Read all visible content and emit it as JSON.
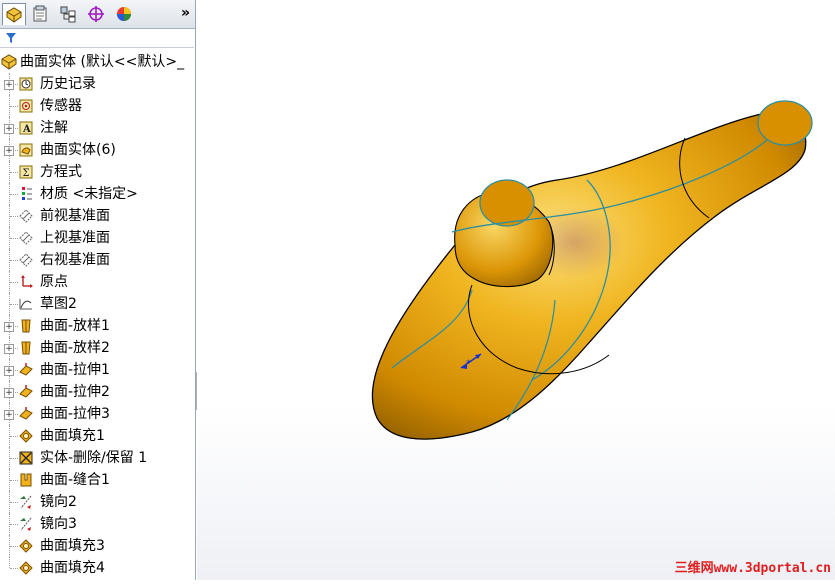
{
  "toolbar": {
    "tabs": [
      {
        "name": "feature-manager",
        "icon": "feature-tree-icon",
        "active": true
      },
      {
        "name": "property-manager",
        "icon": "property-manager-icon",
        "active": false
      },
      {
        "name": "configuration-manager",
        "icon": "configuration-icon",
        "active": false
      },
      {
        "name": "dimxpert",
        "icon": "crosshair-icon",
        "active": false
      },
      {
        "name": "display-manager",
        "icon": "appearance-icon",
        "active": false
      }
    ],
    "more": "»"
  },
  "filter": {
    "icon": "filter-icon"
  },
  "tree": {
    "root": {
      "label": "曲面实体  (默认<<默认>_",
      "icon": "part-icon"
    },
    "items": [
      {
        "label": "历史记录",
        "icon": "history-icon",
        "expandable": true
      },
      {
        "label": "传感器",
        "icon": "sensor-icon",
        "expandable": false
      },
      {
        "label": "注解",
        "icon": "annotation-icon",
        "expandable": true
      },
      {
        "label": "曲面实体(6)",
        "icon": "surface-bodies-icon",
        "expandable": true
      },
      {
        "label": "方程式",
        "icon": "equations-icon",
        "expandable": false
      },
      {
        "label": "材质 <未指定>",
        "icon": "material-icon",
        "expandable": false
      },
      {
        "label": "前视基准面",
        "icon": "plane-icon",
        "expandable": false
      },
      {
        "label": "上视基准面",
        "icon": "plane-icon",
        "expandable": false
      },
      {
        "label": "右视基准面",
        "icon": "plane-icon",
        "expandable": false
      },
      {
        "label": "原点",
        "icon": "origin-icon",
        "expandable": false
      },
      {
        "label": "草图2",
        "icon": "sketch-icon",
        "expandable": false
      },
      {
        "label": "曲面-放样1",
        "icon": "surface-loft-icon",
        "expandable": true
      },
      {
        "label": "曲面-放样2",
        "icon": "surface-loft-icon",
        "expandable": true
      },
      {
        "label": "曲面-拉伸1",
        "icon": "surface-extrude-icon",
        "expandable": true
      },
      {
        "label": "曲面-拉伸2",
        "icon": "surface-extrude-icon",
        "expandable": true
      },
      {
        "label": "曲面-拉伸3",
        "icon": "surface-extrude-icon",
        "expandable": true
      },
      {
        "label": "曲面填充1",
        "icon": "surface-fill-icon",
        "expandable": false
      },
      {
        "label": "实体-删除/保留 1",
        "icon": "delete-body-icon",
        "expandable": false
      },
      {
        "label": "曲面-缝合1",
        "icon": "surface-knit-icon",
        "expandable": false
      },
      {
        "label": "镜向2",
        "icon": "mirror-icon",
        "expandable": false
      },
      {
        "label": "镜向3",
        "icon": "mirror-icon",
        "expandable": false
      },
      {
        "label": "曲面填充3",
        "icon": "surface-fill-icon",
        "expandable": false
      },
      {
        "label": "曲面填充4",
        "icon": "surface-fill-icon",
        "expandable": false
      }
    ]
  },
  "watermark": "三维网www.3dportal.cn",
  "colors": {
    "model": "#e8a30c",
    "edge": "#2d8fa0",
    "tab_bg": "#dde3ea"
  }
}
